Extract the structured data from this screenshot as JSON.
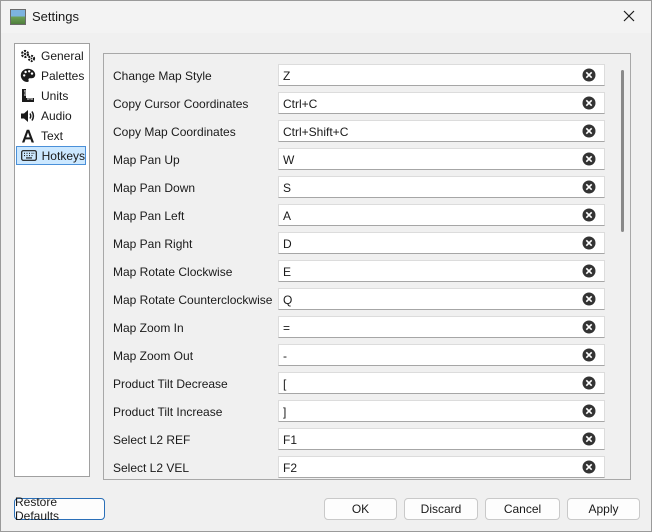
{
  "window": {
    "title": "Settings"
  },
  "sidebar": {
    "items": [
      {
        "label": "General",
        "icon": "gears-icon"
      },
      {
        "label": "Palettes",
        "icon": "palette-icon"
      },
      {
        "label": "Units",
        "icon": "ruler-icon"
      },
      {
        "label": "Audio",
        "icon": "speaker-icon"
      },
      {
        "label": "Text",
        "icon": "text-icon"
      },
      {
        "label": "Hotkeys",
        "icon": "keyboard-icon",
        "selected": true
      }
    ]
  },
  "hotkeys": [
    {
      "label": "Change Map Style",
      "value": "Z"
    },
    {
      "label": "Copy Cursor Coordinates",
      "value": "Ctrl+C"
    },
    {
      "label": "Copy Map Coordinates",
      "value": "Ctrl+Shift+C"
    },
    {
      "label": "Map Pan Up",
      "value": "W"
    },
    {
      "label": "Map Pan Down",
      "value": "S"
    },
    {
      "label": "Map Pan Left",
      "value": "A"
    },
    {
      "label": "Map Pan Right",
      "value": "D"
    },
    {
      "label": "Map Rotate Clockwise",
      "value": "E"
    },
    {
      "label": "Map Rotate Counterclockwise",
      "value": "Q"
    },
    {
      "label": "Map Zoom In",
      "value": "="
    },
    {
      "label": "Map Zoom Out",
      "value": "-"
    },
    {
      "label": "Product Tilt Decrease",
      "value": "["
    },
    {
      "label": "Product Tilt Increase",
      "value": "]"
    },
    {
      "label": "Select L2 REF",
      "value": "F1"
    },
    {
      "label": "Select L2 VEL",
      "value": "F2"
    }
  ],
  "buttons": {
    "restore_defaults": "Restore Defaults",
    "ok": "OK",
    "discard": "Discard",
    "cancel": "Cancel",
    "apply": "Apply"
  },
  "colors": {
    "selection_bg": "#cce8ff",
    "selection_border": "#4a90d9",
    "accent_border": "#2a6fb8"
  }
}
